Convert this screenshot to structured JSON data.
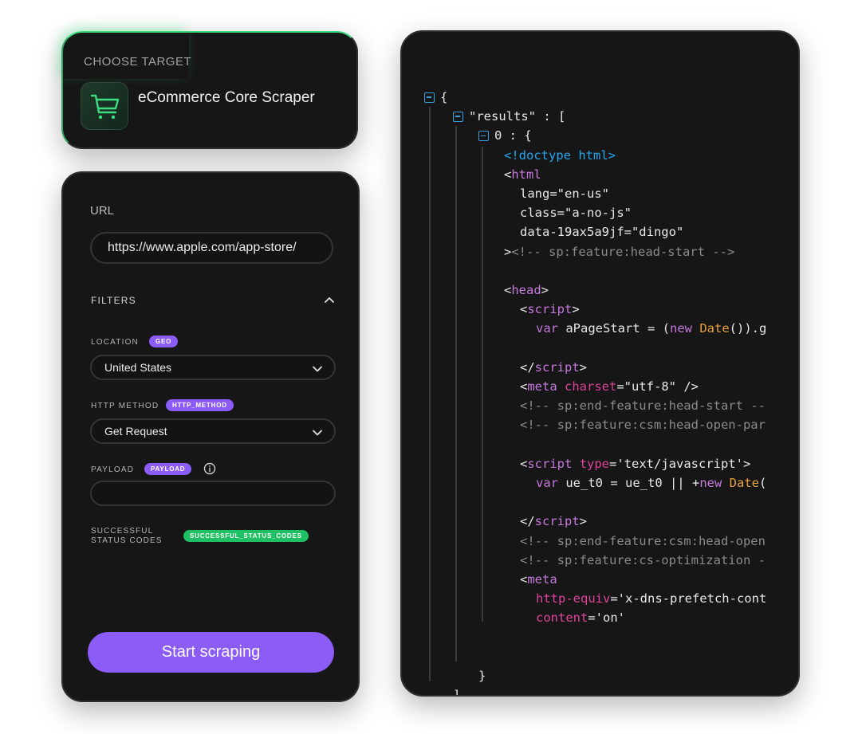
{
  "target": {
    "title": "CHOOSE TARGET",
    "scraper_name": "eCommerce Core Scraper",
    "icon": "shopping-cart-icon",
    "accent": "#3ddc7e"
  },
  "form": {
    "url_label": "URL",
    "url_value": "https://www.apple.com/app-store/",
    "filters_label": "FILTERS",
    "location_label": "LOCATION",
    "location_badge": "GEO",
    "location_value": "United States",
    "method_label": "HTTP METHOD",
    "method_badge": "HTTP_METHOD",
    "method_value": "Get Request",
    "payload_label": "PAYLOAD",
    "payload_badge": "PAYLOAD",
    "payload_value": "",
    "status_label": "SUCCESSFUL STATUS CODES",
    "status_badge": "SUCCESSFUL_STATUS_CODES",
    "start_button": "Start scraping",
    "accent": "#8c5cf6",
    "status_color": "#1fbf63"
  },
  "code": {
    "lines": [
      {
        "indent": 0,
        "fold": true,
        "tokens": [
          [
            "{",
            "p"
          ]
        ]
      },
      {
        "indent": 1,
        "fold": true,
        "tokens": [
          [
            "\"results\" : [",
            "p"
          ]
        ]
      },
      {
        "indent": 2,
        "fold": true,
        "tokens": [
          [
            "0 : {",
            "p"
          ]
        ]
      },
      {
        "indent": 3,
        "tokens": [
          [
            "<!doctype html>",
            "kw"
          ]
        ]
      },
      {
        "indent": 3,
        "tokens": [
          [
            "<",
            "p"
          ],
          [
            "html",
            "tag"
          ]
        ]
      },
      {
        "indent": 4,
        "tokens": [
          [
            "lang=\"en-us\"",
            "p"
          ]
        ]
      },
      {
        "indent": 4,
        "tokens": [
          [
            "class=\"a-no-js\"",
            "p"
          ]
        ]
      },
      {
        "indent": 4,
        "tokens": [
          [
            "data-19ax5a9jf=\"dingo\"",
            "p"
          ]
        ]
      },
      {
        "indent": 3,
        "tokens": [
          [
            ">",
            "p"
          ],
          [
            "<!-- sp:feature:head-start -->",
            "com"
          ]
        ]
      },
      {
        "indent": 3,
        "tokens": []
      },
      {
        "indent": 3,
        "tokens": [
          [
            "<",
            "p"
          ],
          [
            "head",
            "tag"
          ],
          [
            ">",
            "p"
          ]
        ]
      },
      {
        "indent": 4,
        "tokens": [
          [
            "<",
            "p"
          ],
          [
            "script",
            "tag"
          ],
          [
            ">",
            "p"
          ]
        ]
      },
      {
        "indent": 5,
        "tokens": [
          [
            "var",
            "tag"
          ],
          [
            " aPageStart = (",
            "p"
          ],
          [
            "new",
            "tag"
          ],
          [
            " ",
            "p"
          ],
          [
            "Date",
            "fn"
          ],
          [
            "()).g",
            "p"
          ]
        ]
      },
      {
        "indent": 5,
        "tokens": []
      },
      {
        "indent": 4,
        "tokens": [
          [
            "</",
            "p"
          ],
          [
            "script",
            "tag"
          ],
          [
            ">",
            "p"
          ]
        ]
      },
      {
        "indent": 4,
        "tokens": [
          [
            "<",
            "p"
          ],
          [
            "meta",
            "tag"
          ],
          [
            " ",
            "p"
          ],
          [
            "charset",
            "attr"
          ],
          [
            "=\"utf-8\" />",
            "p"
          ]
        ]
      },
      {
        "indent": 4,
        "tokens": [
          [
            "<!-- sp:end-feature:head-start --",
            "com"
          ]
        ]
      },
      {
        "indent": 4,
        "tokens": [
          [
            "<!-- sp:feature:csm:head-open-par",
            "com"
          ]
        ]
      },
      {
        "indent": 4,
        "tokens": []
      },
      {
        "indent": 4,
        "tokens": [
          [
            "<",
            "p"
          ],
          [
            "script",
            "tag"
          ],
          [
            " ",
            "p"
          ],
          [
            "type",
            "attr"
          ],
          [
            "='text/javascript'>",
            "p"
          ]
        ]
      },
      {
        "indent": 5,
        "tokens": [
          [
            "var",
            "tag"
          ],
          [
            " ue_t0 = ue_t0 || +",
            "p"
          ],
          [
            "new",
            "tag"
          ],
          [
            " ",
            "p"
          ],
          [
            "Date",
            "fn"
          ],
          [
            "(",
            "p"
          ]
        ]
      },
      {
        "indent": 5,
        "tokens": []
      },
      {
        "indent": 4,
        "tokens": [
          [
            "</",
            "p"
          ],
          [
            "script",
            "tag"
          ],
          [
            ">",
            "p"
          ]
        ]
      },
      {
        "indent": 4,
        "tokens": [
          [
            "<!-- sp:end-feature:csm:head-open",
            "com"
          ]
        ]
      },
      {
        "indent": 4,
        "tokens": [
          [
            "<!-- sp:feature:cs-optimization -",
            "com"
          ]
        ]
      },
      {
        "indent": 4,
        "tokens": [
          [
            "<",
            "p"
          ],
          [
            "meta",
            "tag"
          ]
        ]
      },
      {
        "indent": 5,
        "tokens": [
          [
            "http-equiv",
            "attr"
          ],
          [
            "='x-dns-prefetch-cont",
            "p"
          ]
        ]
      },
      {
        "indent": 5,
        "tokens": [
          [
            "content",
            "attr"
          ],
          [
            "='on'",
            "p"
          ]
        ]
      },
      {
        "indent": 5,
        "tokens": []
      },
      {
        "indent": 5,
        "tokens": []
      },
      {
        "indent": 2,
        "tokens": [
          [
            "}",
            "p"
          ]
        ]
      },
      {
        "indent": 1,
        "tokens": [
          [
            "]",
            "p"
          ]
        ]
      },
      {
        "indent": 0,
        "tokens": [
          [
            "}",
            "p"
          ]
        ]
      }
    ]
  }
}
